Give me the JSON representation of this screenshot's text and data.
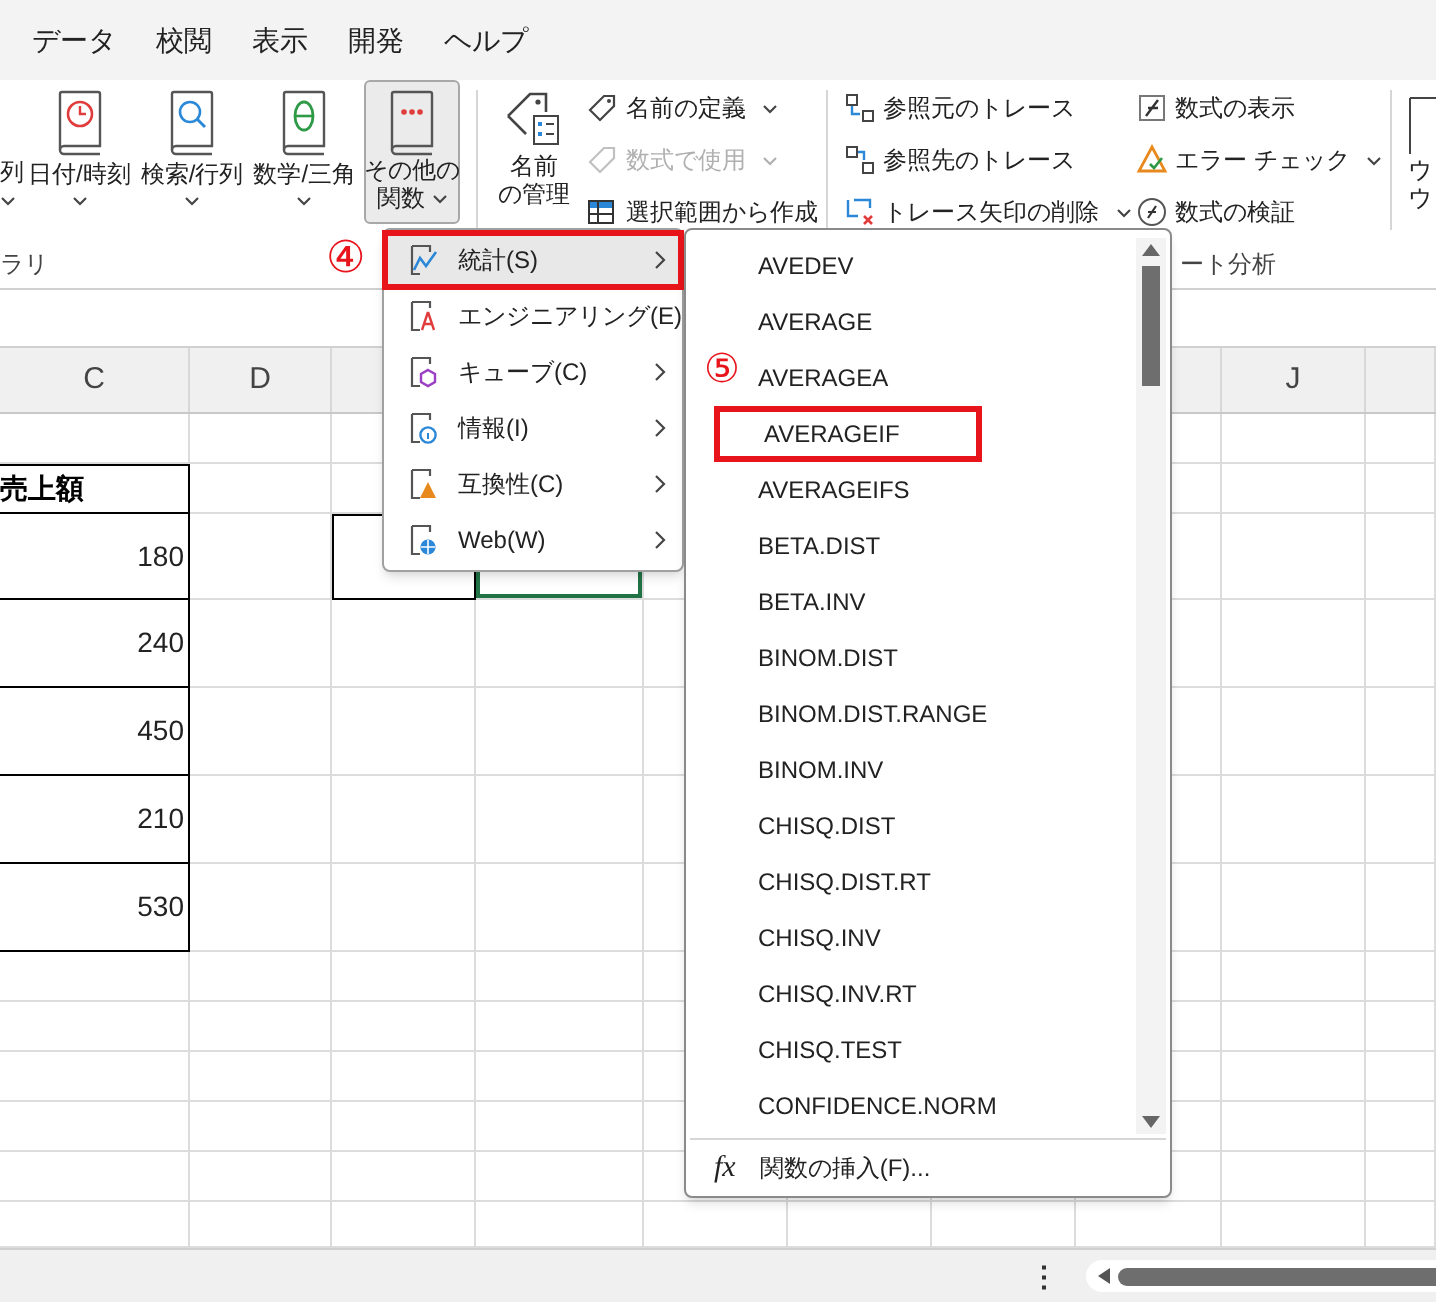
{
  "ribbon_tabs": [
    "データ",
    "校閲",
    "表示",
    "開発",
    "ヘルプ"
  ],
  "function_library": {
    "cut_label": "列",
    "buttons": [
      {
        "lines": [
          "日付/時刻"
        ],
        "selected": false
      },
      {
        "lines": [
          "検索/行列"
        ],
        "selected": false
      },
      {
        "lines": [
          "数学/三角"
        ],
        "selected": false
      },
      {
        "lines": [
          "その他の",
          "関数"
        ],
        "selected": true
      }
    ],
    "group_label": "ラリ"
  },
  "defined_names": {
    "manager": [
      "名前",
      "の管理"
    ],
    "commands": [
      {
        "label": "名前の定義",
        "dropdown": true,
        "disabled": false
      },
      {
        "label": "数式で使用",
        "dropdown": true,
        "disabled": true
      },
      {
        "label": "選択範囲から作成",
        "dropdown": false,
        "disabled": false
      }
    ]
  },
  "formula_auditing": {
    "commands": [
      {
        "label": "参照元のトレース",
        "dropdown": false
      },
      {
        "label": "参照先のトレース",
        "dropdown": false
      },
      {
        "label": "トレース矢印の削除",
        "dropdown": true
      },
      {
        "label": "数式の表示",
        "dropdown": false
      },
      {
        "label": "エラー チェック",
        "dropdown": true
      },
      {
        "label": "数式の検証",
        "dropdown": false
      }
    ],
    "group_label": "ート分析"
  },
  "watch_window": [
    "ウ",
    "ウ"
  ],
  "sheet": {
    "columns": [
      "C",
      "D",
      "J"
    ],
    "header_cell": "売上額",
    "values": [
      "180",
      "240",
      "450",
      "210",
      "530"
    ]
  },
  "more_functions_menu": {
    "items": [
      {
        "label": "統計(S)",
        "selected": true,
        "marked": true
      },
      {
        "label": "エンジニアリング(E)",
        "selected": false,
        "marked": false
      },
      {
        "label": "キューブ(C)",
        "selected": false,
        "marked": false
      },
      {
        "label": "情報(I)",
        "selected": false,
        "marked": false
      },
      {
        "label": "互換性(C)",
        "selected": false,
        "marked": false
      },
      {
        "label": "Web(W)",
        "selected": false,
        "marked": false
      }
    ]
  },
  "statistical_submenu": {
    "items": [
      {
        "label": "AVEDEV",
        "marked": false
      },
      {
        "label": "AVERAGE",
        "marked": false
      },
      {
        "label": "AVERAGEA",
        "marked": false
      },
      {
        "label": "AVERAGEIF",
        "marked": true
      },
      {
        "label": "AVERAGEIFS",
        "marked": false
      },
      {
        "label": "BETA.DIST",
        "marked": false
      },
      {
        "label": "BETA.INV",
        "marked": false
      },
      {
        "label": "BINOM.DIST",
        "marked": false
      },
      {
        "label": "BINOM.DIST.RANGE",
        "marked": false
      },
      {
        "label": "BINOM.INV",
        "marked": false
      },
      {
        "label": "CHISQ.DIST",
        "marked": false
      },
      {
        "label": "CHISQ.DIST.RT",
        "marked": false
      },
      {
        "label": "CHISQ.INV",
        "marked": false
      },
      {
        "label": "CHISQ.INV.RT",
        "marked": false
      },
      {
        "label": "CHISQ.TEST",
        "marked": false
      },
      {
        "label": "CONFIDENCE.NORM",
        "marked": false
      }
    ],
    "footer_icon": "fx",
    "footer": "関数の挿入(F)..."
  },
  "annotations": [
    "④",
    "⑤"
  ],
  "status_bar": {
    "menu": "⋮"
  }
}
